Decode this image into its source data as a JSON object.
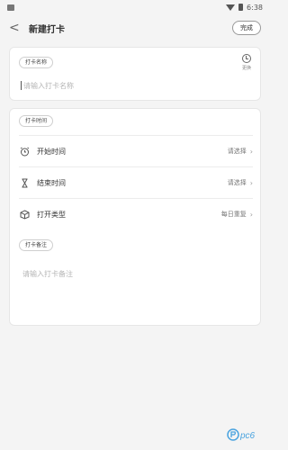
{
  "status": {
    "time": "6:38"
  },
  "nav": {
    "back_symbol": "<",
    "title": "新建打卡",
    "done_label": "完成"
  },
  "name_card": {
    "tag": "打卡名称",
    "placeholder": "请输入打卡名称",
    "change_label": "更换"
  },
  "time_card": {
    "tag": "打卡时间",
    "rows": [
      {
        "label": "开始时间",
        "value": "请选择",
        "icon": "alarm-clock-icon"
      },
      {
        "label": "结束时间",
        "value": "请选择",
        "icon": "hourglass-icon"
      },
      {
        "label": "打开类型",
        "value": "每日重复",
        "icon": "cube-icon"
      }
    ],
    "note_tag": "打卡备注",
    "note_placeholder": "请输入打卡备注"
  },
  "colors": {
    "background": "#f4f4f4",
    "card": "#ffffff",
    "border": "#e6e6e6"
  }
}
